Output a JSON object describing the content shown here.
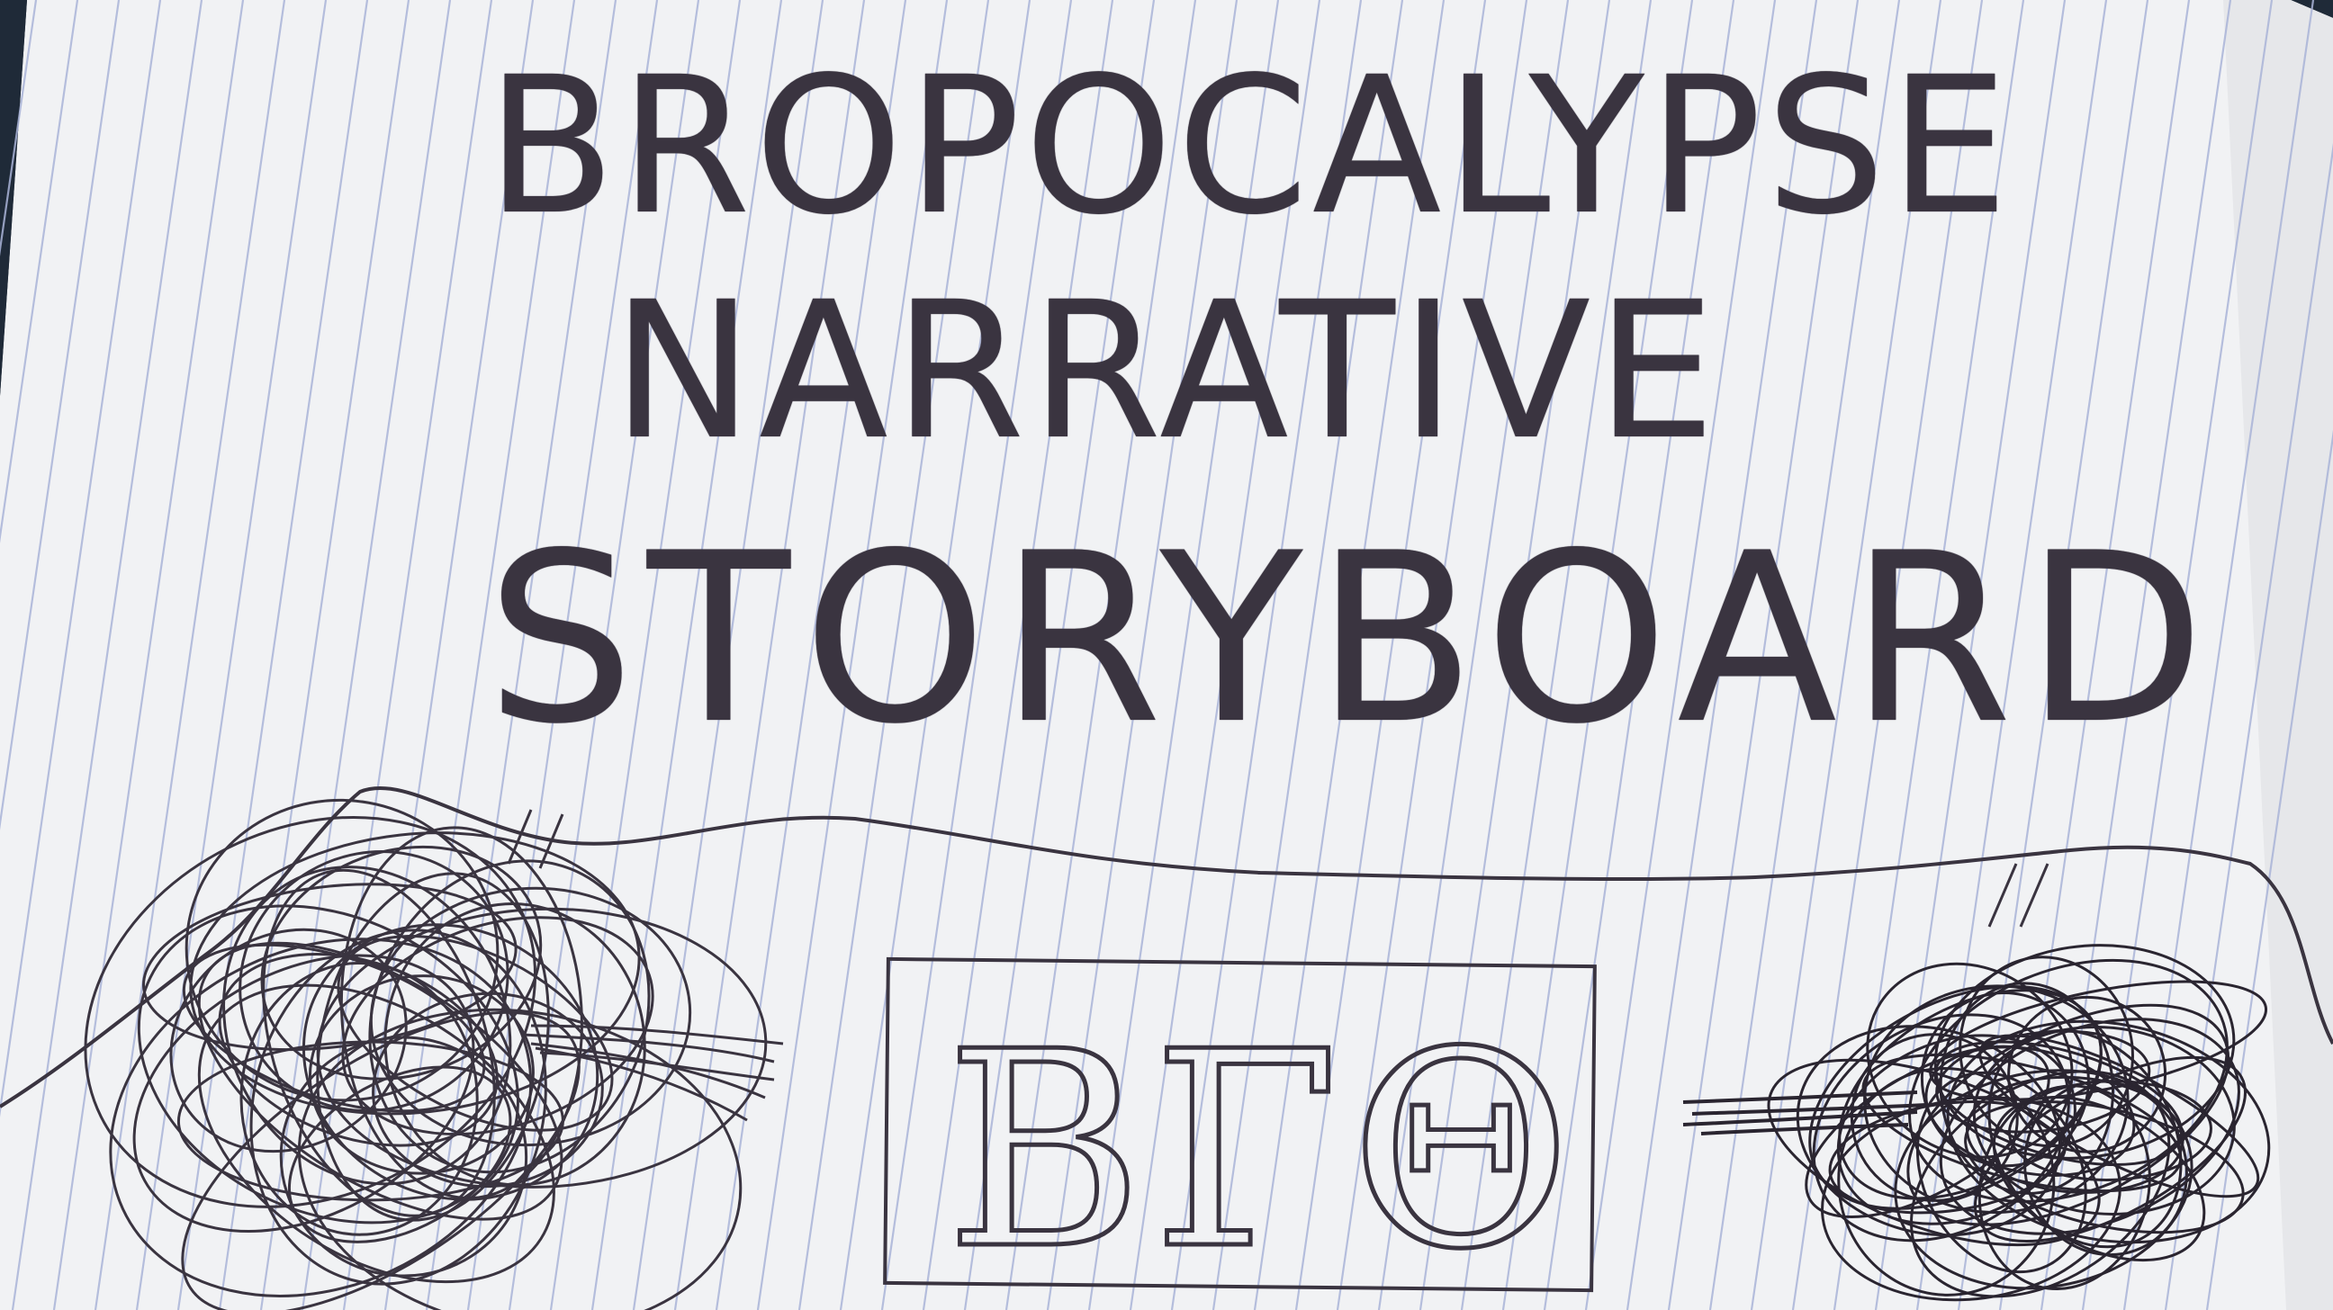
{
  "title": {
    "line1": "BROPOCALYPSE",
    "line2": "NARRATIVE",
    "line3": "STORYBOARD"
  },
  "logo": {
    "letters": [
      "B",
      "Γ",
      "Θ"
    ]
  },
  "colors": {
    "paper": "#f1f2f4",
    "rule_lines": "#a9b4d6",
    "ink": "#3a3440",
    "background": "#1f2a38"
  }
}
